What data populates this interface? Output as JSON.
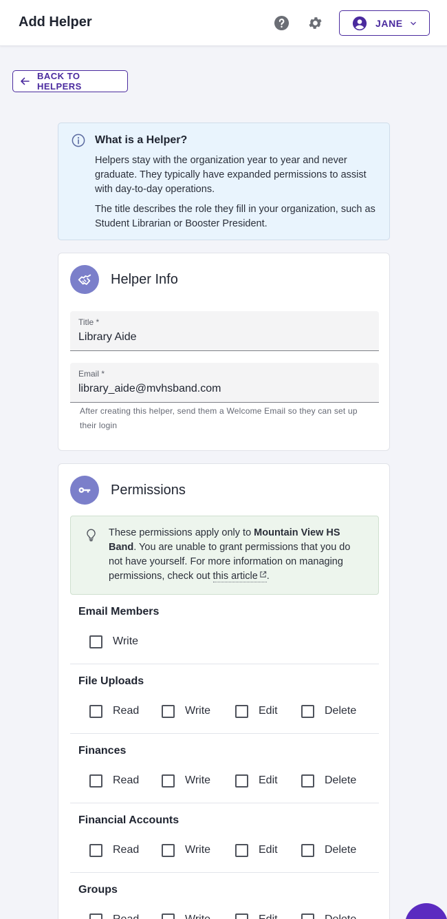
{
  "header": {
    "title": "Add Helper",
    "user_label": "JANE",
    "icons": [
      "help-circle-icon",
      "gear-icon",
      "account-circle-icon",
      "chevron-down-icon"
    ]
  },
  "back_label": "BACK TO HELPERS",
  "info": {
    "heading": "What is a Helper?",
    "paragraph1": "Helpers stay with the organization year to year and never graduate. They typically have expanded permissions to assist with day-to-day operations.",
    "paragraph2": "The title describes the role they fill in your organization, such as Student Librarian or Booster President."
  },
  "helper_info": {
    "title": "Helper Info",
    "title_field": {
      "label": "Title *",
      "value": "Library Aide"
    },
    "email_field": {
      "label": "Email *",
      "value": "library_aide@mvhsband.com"
    },
    "hint": "After creating this helper, send them a Welcome Email so they can set up their login"
  },
  "permissions": {
    "title": "Permissions",
    "tip": {
      "part1": "These permissions apply only to ",
      "org": "Mountain View HS Band",
      "part2": ". You are unable to grant permissions that you do not have yourself. For more information on managing permissions, check out ",
      "link": "this article",
      "part3": "."
    },
    "groups": [
      {
        "name": "Email Members",
        "options": [
          "Write"
        ]
      },
      {
        "name": "File Uploads",
        "options": [
          "Read",
          "Write",
          "Edit",
          "Delete"
        ]
      },
      {
        "name": "Finances",
        "options": [
          "Read",
          "Write",
          "Edit",
          "Delete"
        ]
      },
      {
        "name": "Financial Accounts",
        "options": [
          "Read",
          "Write",
          "Edit",
          "Delete"
        ]
      },
      {
        "name": "Groups",
        "options": [
          "Read",
          "Write",
          "Edit",
          "Delete"
        ]
      }
    ]
  },
  "colors": {
    "accent": "#4a2a9e",
    "info_bg": "#e9f4fd",
    "tip_bg": "#edf5ed",
    "card_icon_bg": "#7b7fca",
    "fab": "#5b2bc0"
  }
}
